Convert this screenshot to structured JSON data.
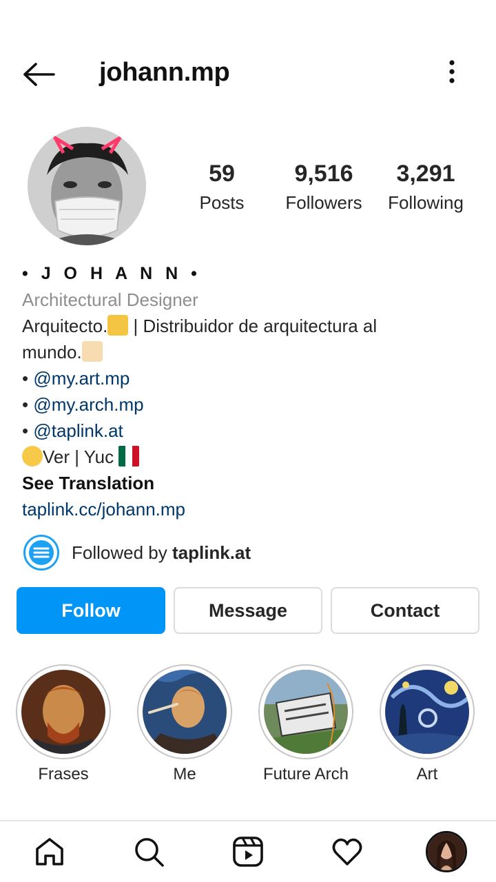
{
  "header": {
    "username": "johann.mp",
    "back_icon": "arrow-left-icon",
    "more_icon": "vertical-dots-icon"
  },
  "stats": {
    "posts": {
      "value": "59",
      "label": "Posts"
    },
    "followers": {
      "value": "9,516",
      "label": "Followers"
    },
    "following": {
      "value": "3,291",
      "label": "Following"
    }
  },
  "bio": {
    "name": "• J O H A N N •",
    "category": "Architectural Designer",
    "line1": "Arquitecto.",
    "line1_rest": " | Distribuidor de arquitectura al",
    "line2": "mundo.",
    "mention_prefix": "• ",
    "mentions": [
      "@my.art.mp",
      "@my.arch.mp",
      "@taplink.at"
    ],
    "location": "Ver | Yuc ",
    "see_translation": "See Translation",
    "link": "taplink.cc/johann.mp"
  },
  "followed_by": {
    "prefix": "Followed by ",
    "user": "taplink.at"
  },
  "buttons": {
    "follow": "Follow",
    "message": "Message",
    "contact": "Contact"
  },
  "highlights": [
    {
      "label": "Frases"
    },
    {
      "label": "Me"
    },
    {
      "label": "Future Arch"
    },
    {
      "label": "Art"
    }
  ],
  "colors": {
    "accent": "#0095f6",
    "link": "#00376b",
    "muted": "#8e8e8e"
  },
  "nav": {
    "icons": [
      "home-icon",
      "search-icon",
      "reels-icon",
      "heart-icon",
      "profile-avatar"
    ]
  }
}
